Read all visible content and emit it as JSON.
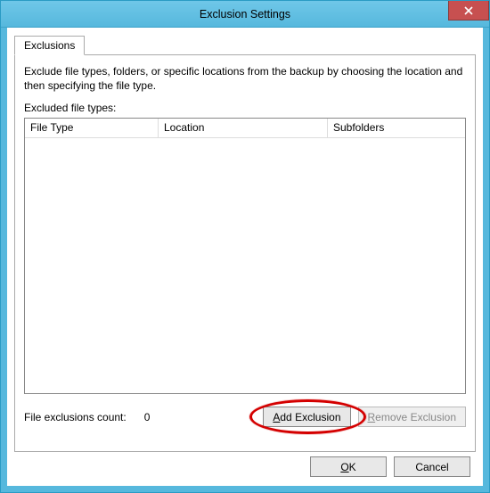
{
  "window": {
    "title": "Exclusion Settings",
    "close_label": "Close"
  },
  "tab": {
    "label": "Exclusions"
  },
  "panel": {
    "description": "Exclude file types, folders, or specific locations from the backup by choosing the location and then specifying the file type.",
    "list_label": "Excluded file types:",
    "columns": {
      "file_type": "File Type",
      "location": "Location",
      "subfolders": "Subfolders"
    },
    "rows": []
  },
  "footer": {
    "count_label": "File exclusions count:",
    "count_value": "0",
    "add_label": "Add Exclusion",
    "remove_label": "Remove Exclusion"
  },
  "dialog": {
    "ok": "OK",
    "cancel": "Cancel"
  }
}
